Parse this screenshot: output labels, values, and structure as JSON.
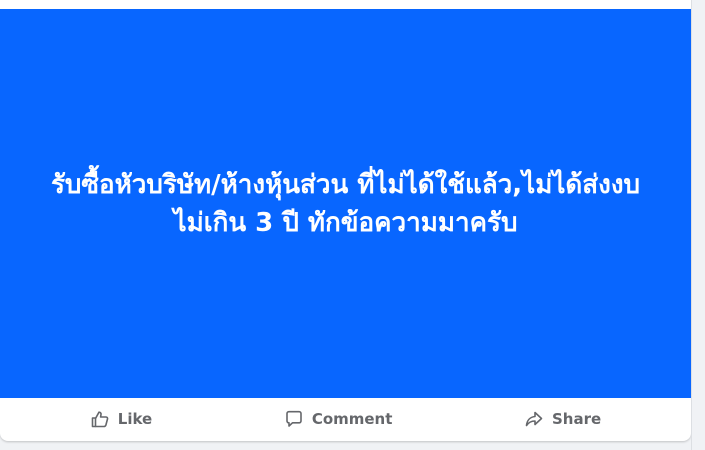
{
  "post": {
    "background_color": "#0866ff",
    "text": "รับซื้อหัวบริษัท/ห้างหุ้นส่วน ที่ไม่ได้ใช้แล้ว,ไม่ได้ส่งงบไม่เกิน 3 ปี ทักข้อความมาครับ",
    "text_color": "#ffffff"
  },
  "actions": {
    "like_label": "Like",
    "like_icon": "thumbs-up-icon",
    "comment_label": "Comment",
    "comment_icon": "speech-bubble-icon",
    "share_label": "Share",
    "share_icon": "share-arrow-icon"
  }
}
